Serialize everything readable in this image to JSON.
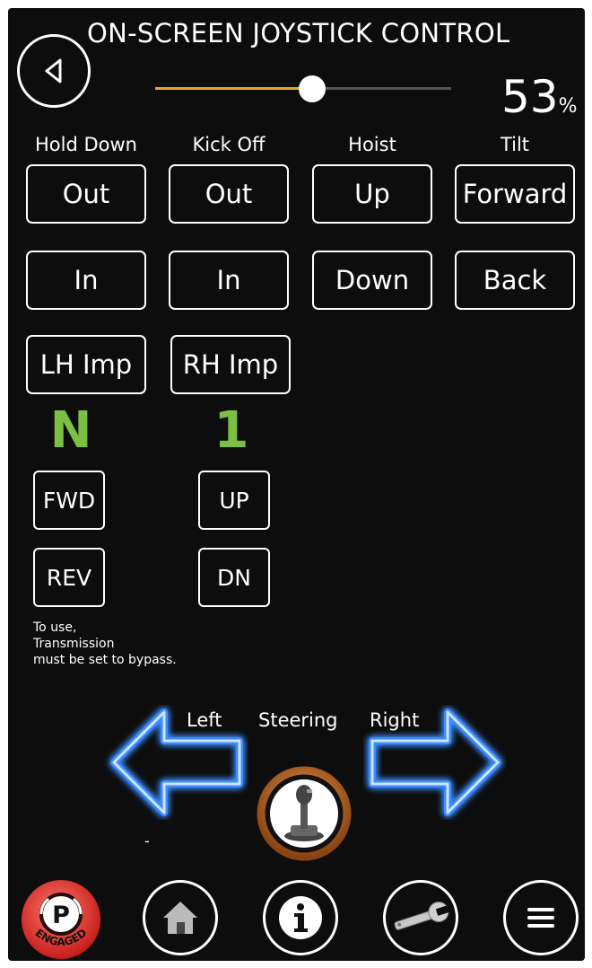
{
  "header": {
    "title": "ON-SCREEN JOYSTICK CONTROL",
    "back_icon": "back-triangle-icon"
  },
  "speed": {
    "value_text": "53",
    "unit": "%",
    "level_fraction": 0.53,
    "fill_color": "#e7a41f"
  },
  "columns": [
    {
      "label": "Hold Down",
      "top_button": "Out",
      "bottom_button": "In"
    },
    {
      "label": "Kick Off",
      "top_button": "Out",
      "bottom_button": "In"
    },
    {
      "label": "Hoist",
      "top_button": "Up",
      "bottom_button": "Down"
    },
    {
      "label": "Tilt",
      "top_button": "Forward",
      "bottom_button": "Back"
    }
  ],
  "impellers": {
    "left": "LH Imp",
    "right": "RH Imp"
  },
  "transmission": {
    "direction_indicator": "N",
    "gear_indicator": "1",
    "indicator_color": "#7bc043",
    "fwd": "FWD",
    "rev": "REV",
    "up": "UP",
    "dn": "DN",
    "note_lines": [
      "To use,",
      "Transmission",
      "must be set to bypass."
    ]
  },
  "steering": {
    "left_label": "Left",
    "center_label": "Steering",
    "right_label": "Right",
    "dash": "-",
    "arrow_glow_color": "#3d8cff",
    "joystick_ring_color": "#d4792a"
  },
  "bottom_bar": {
    "park": {
      "letter": "P",
      "badge": "ENGAGED",
      "color": "#e02a2a"
    },
    "icons": [
      "home-icon",
      "info-icon",
      "wrench-icon",
      "menu-icon"
    ]
  }
}
